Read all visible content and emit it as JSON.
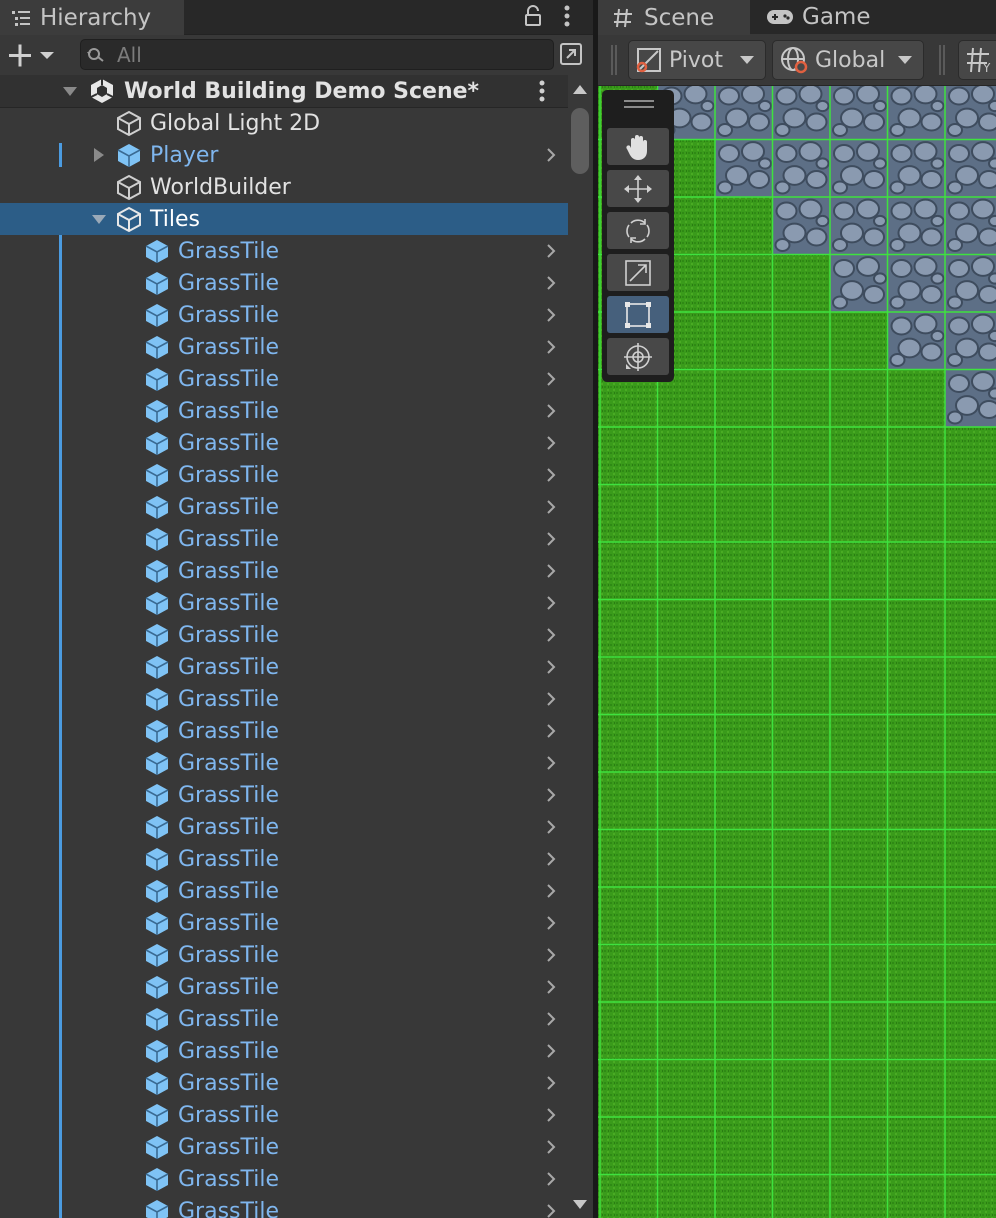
{
  "hierarchy": {
    "tab_title": "Hierarchy",
    "search_placeholder": "All",
    "scene_name": "World Building Demo Scene*",
    "items": [
      {
        "label": "Global Light 2D",
        "prefab": false
      },
      {
        "label": "Player",
        "prefab": true
      },
      {
        "label": "WorldBuilder",
        "prefab": false
      },
      {
        "label": "Tiles",
        "prefab": false,
        "selected": true
      }
    ],
    "child_label": "GrassTile",
    "child_count": 31
  },
  "scene": {
    "tab_scene": "Scene",
    "tab_game": "Game",
    "pivot_label": "Pivot",
    "global_label": "Global"
  },
  "tools": [
    "hand-tool",
    "move-tool",
    "rotate-tool",
    "scale-tool",
    "rect-tool",
    "transform-tool"
  ],
  "colors": {
    "selection": "#2c5d87",
    "prefab_blue": "#7fb6ee",
    "grass": "#3a9b1b",
    "grid_line": "#3ee23e",
    "stone": "#8a9ab0"
  }
}
